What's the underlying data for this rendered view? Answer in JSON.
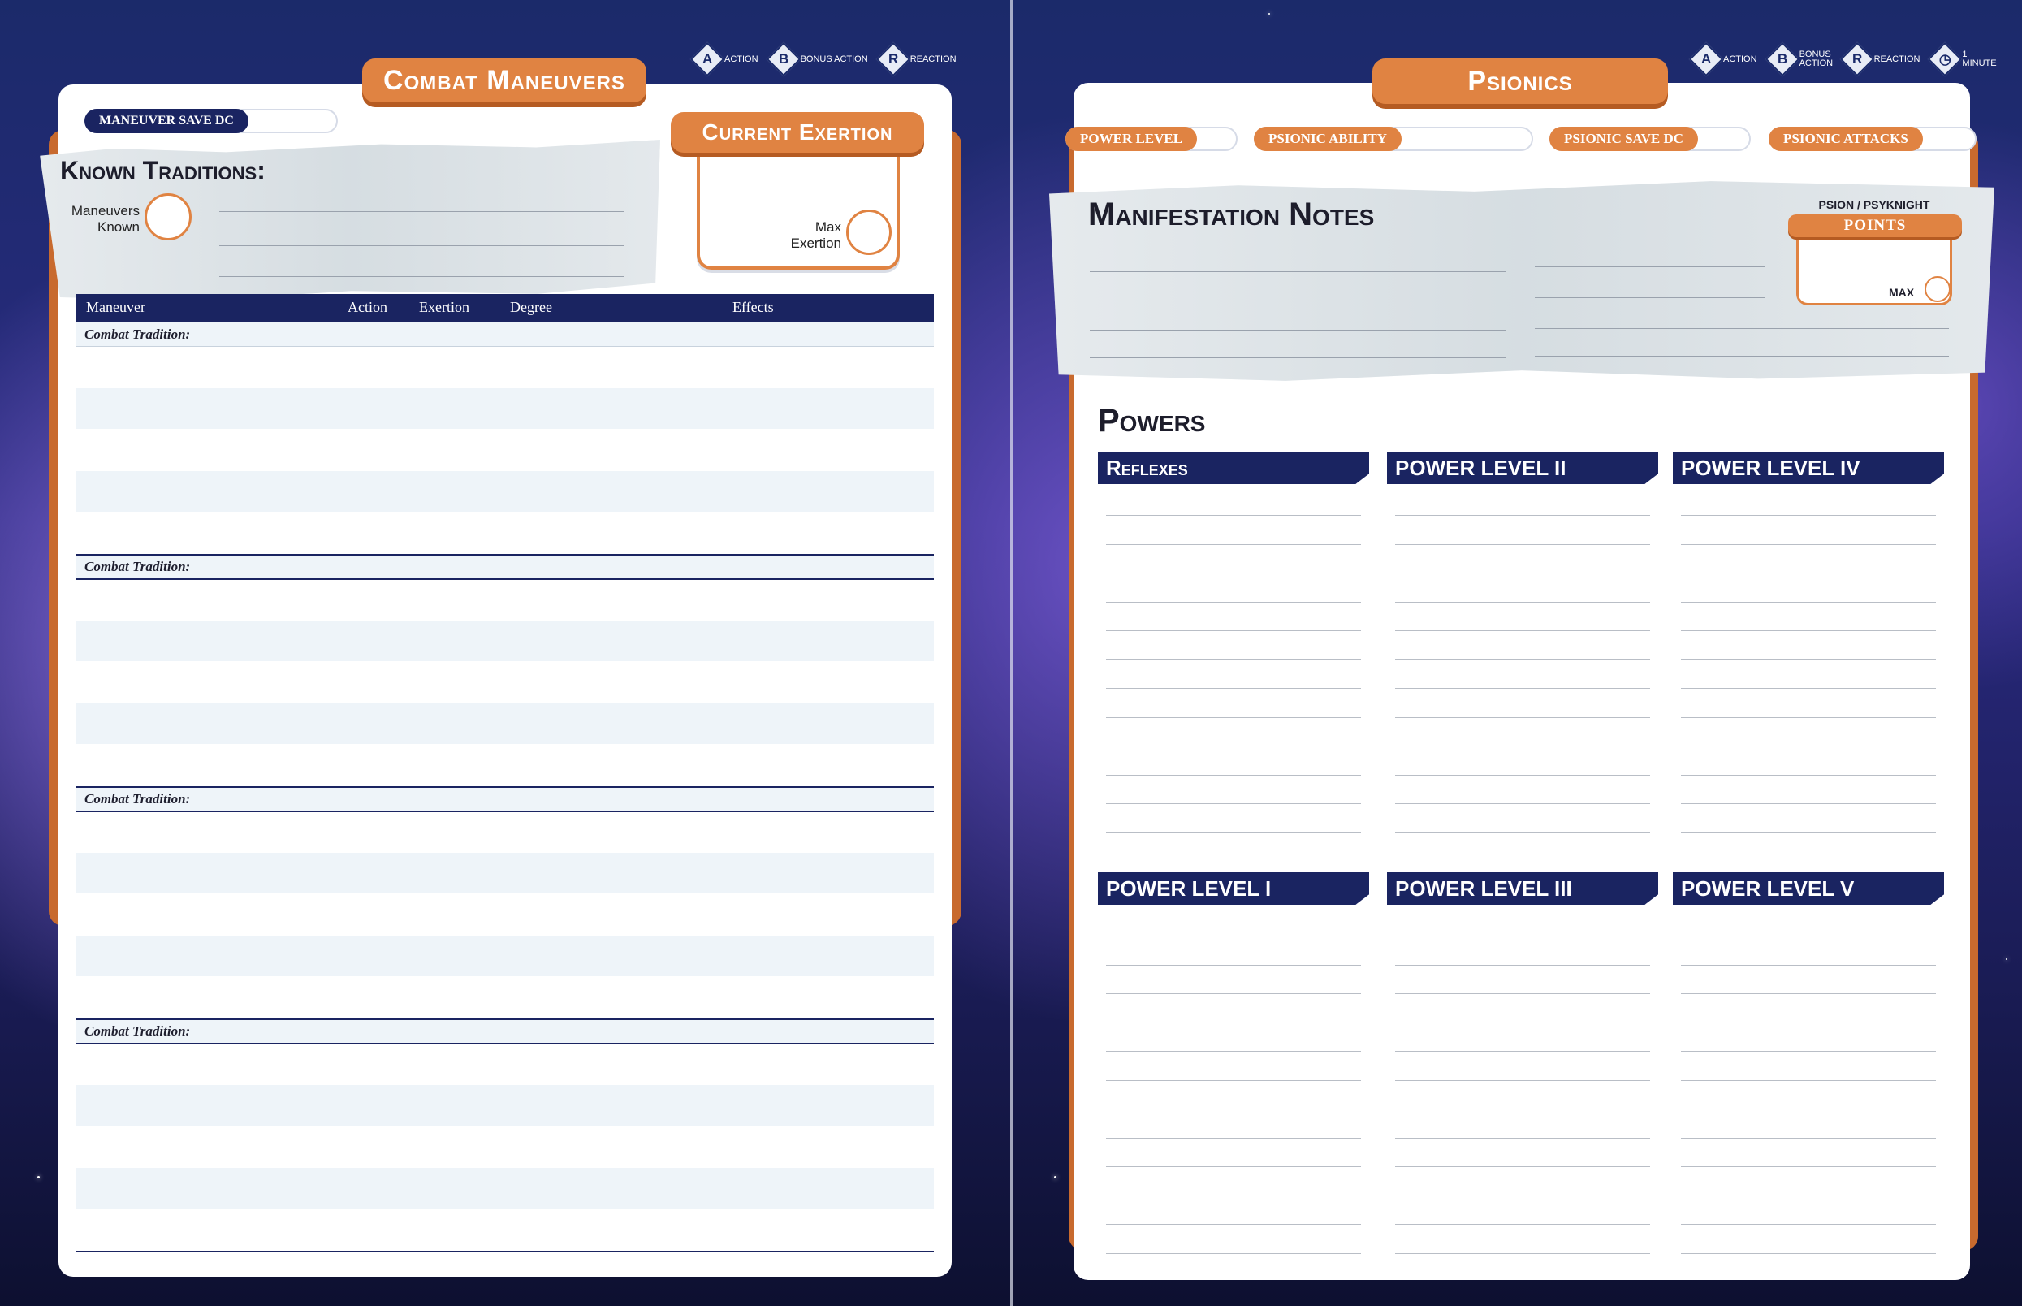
{
  "legend_left": [
    {
      "icon": "action-icon",
      "glyph": "A",
      "label": "Action"
    },
    {
      "icon": "bonus-action-icon",
      "glyph": "B",
      "label": "Bonus Action"
    },
    {
      "icon": "reaction-icon",
      "glyph": "R",
      "label": "Reaction"
    }
  ],
  "legend_right": [
    {
      "icon": "action-icon",
      "glyph": "A",
      "label": "Action"
    },
    {
      "icon": "bonus-action-icon",
      "glyph": "B",
      "label": "Bonus Action"
    },
    {
      "icon": "reaction-icon",
      "glyph": "R",
      "label": "Reaction"
    },
    {
      "icon": "minute-icon",
      "glyph": "◷",
      "label": "1 Minute"
    }
  ],
  "combat": {
    "title": "Combat Maneuvers",
    "save_dc_label": "Maneuver Save DC",
    "known_traditions": "Known Traditions:",
    "maneuvers_known": "Maneuvers Known",
    "current_exertion": "Current Exertion",
    "max_exertion": "Max Exertion",
    "table_headers": {
      "maneuver": "Maneuver",
      "action": "Action",
      "exertion": "Exertion",
      "degree": "Degree",
      "effects": "Effects"
    },
    "section_label": "Combat Tradition:"
  },
  "psionics": {
    "title": "Psionics",
    "fields": [
      "Power Level",
      "Psionic Ability",
      "Psionic Save DC",
      "Psionic Attacks"
    ],
    "notes_heading": "Manifestation Notes",
    "psion_label": "Psion / Psyknight",
    "points_label": "Points",
    "max_label": "Max",
    "powers_heading": "Powers",
    "columns": [
      "Reflexes",
      "POWER LEVEL II",
      "POWER LEVEL IV",
      "POWER LEVEL I",
      "POWER LEVEL III",
      "POWER LEVEL V"
    ]
  },
  "colors": {
    "navy": "#1a2461",
    "orange": "#e08342",
    "page": "#ffffff"
  }
}
